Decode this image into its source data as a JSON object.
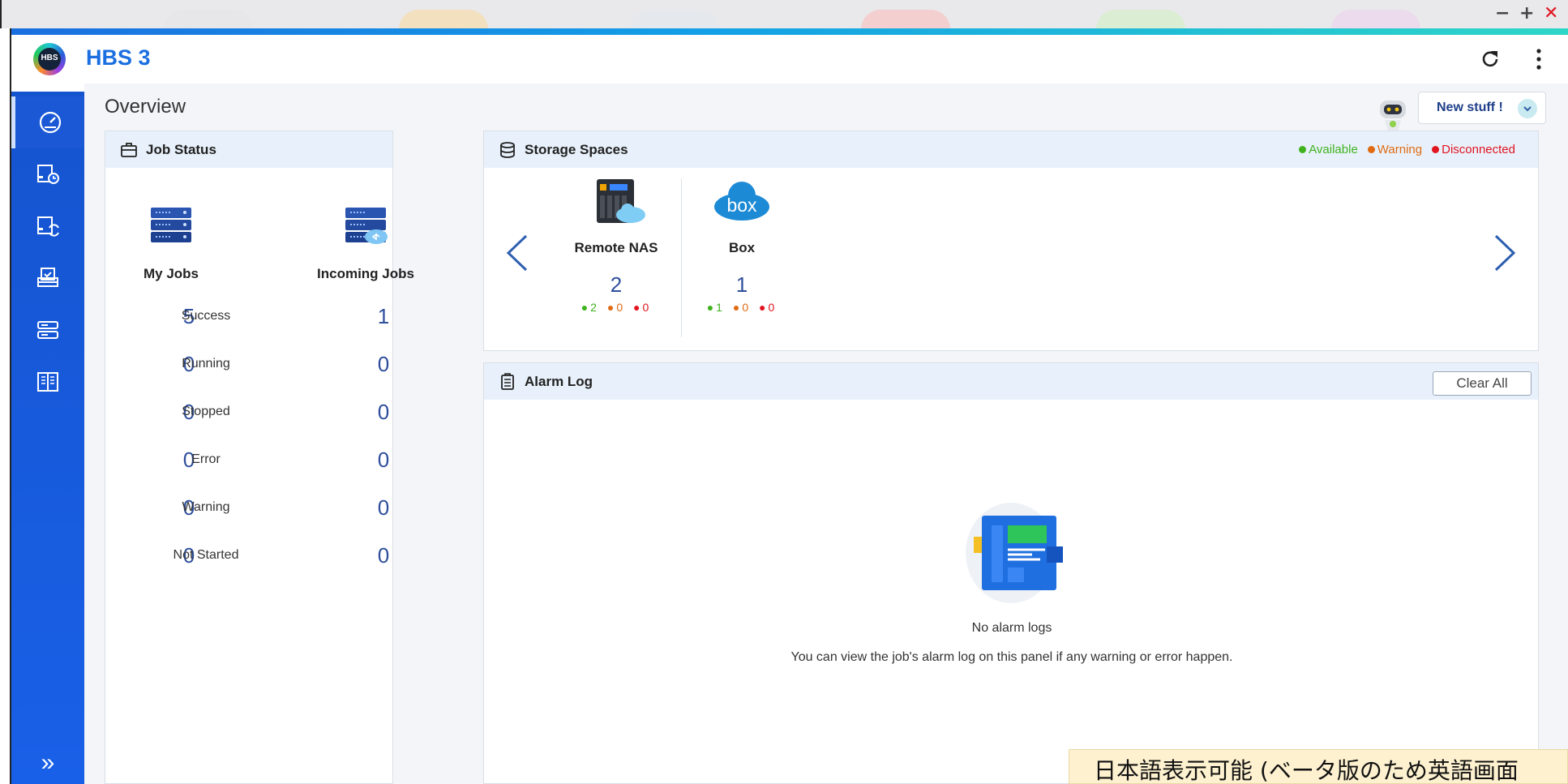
{
  "window": {
    "minimize": "−",
    "maximize": "+",
    "close": "✕"
  },
  "app": {
    "logo_text": "HBS",
    "title": "HBS 3"
  },
  "header": {
    "icons": [
      "refresh-icon",
      "more-vert-icon"
    ]
  },
  "sidebar": {
    "items": [
      "overview-icon",
      "backup-icon",
      "sync-icon",
      "restore-icon",
      "storage-icon",
      "logs-icon"
    ],
    "expand": "»"
  },
  "page": {
    "title": "Overview",
    "new_stuff": "New stuff !"
  },
  "job_status": {
    "title": "Job Status",
    "columns": [
      "My Jobs",
      "Incoming Jobs"
    ],
    "rows": [
      {
        "label": "Success",
        "my": "5",
        "incoming": "1"
      },
      {
        "label": "Running",
        "my": "0",
        "incoming": "0"
      },
      {
        "label": "Stopped",
        "my": "0",
        "incoming": "0"
      },
      {
        "label": "Error",
        "my": "0",
        "incoming": "0"
      },
      {
        "label": "Warning",
        "my": "0",
        "incoming": "0"
      },
      {
        "label": "Not Started",
        "my": "0",
        "incoming": "0"
      }
    ]
  },
  "storage": {
    "title": "Storage Spaces",
    "legend": {
      "available": "Available",
      "warning": "Warning",
      "disconnected": "Disconnected"
    },
    "items": [
      {
        "name": "Remote NAS",
        "count": "2",
        "available": "2",
        "warning": "0",
        "disconnected": "0"
      },
      {
        "name": "Box",
        "count": "1",
        "available": "1",
        "warning": "0",
        "disconnected": "0"
      }
    ],
    "box_logo": "box"
  },
  "alarm": {
    "title": "Alarm Log",
    "clear_label": "Clear All",
    "empty_title": "No alarm logs",
    "empty_desc": "You can view the job's alarm log on this panel if any warning or error happen."
  },
  "colors": {
    "accent": "#1b6fe0",
    "available": "#3fb21d",
    "warning": "#e06b12",
    "disconnected": "#e1141f"
  },
  "watermark": "日本語表示可能 (ベータ版のため英語画面"
}
